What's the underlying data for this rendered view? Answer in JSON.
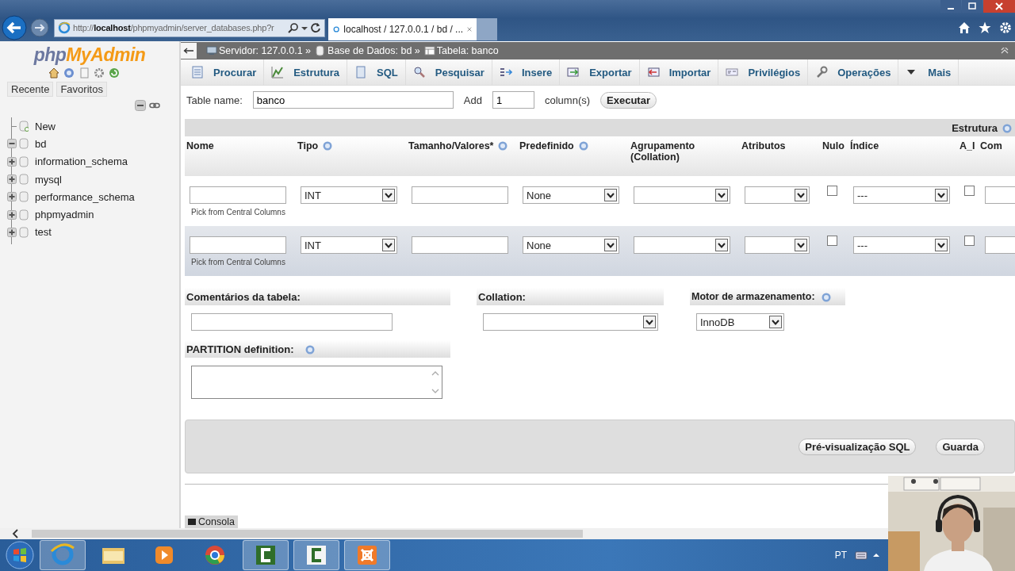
{
  "browser": {
    "address": "http://**localhost**/phpmyadmin/server_databases.php?r",
    "tabs": [
      {
        "title": "localhost / 127.0.0.1 / bd / ...",
        "selected": true
      }
    ]
  },
  "sidebar": {
    "logo": [
      "php",
      "MyAdmin"
    ],
    "tabs": [
      {
        "label": "Recente"
      },
      {
        "label": "Favoritos"
      }
    ],
    "tree": [
      {
        "label": "New",
        "kind": "new"
      },
      {
        "label": "bd",
        "kind": "database",
        "expanded": true
      },
      {
        "label": "information_schema",
        "kind": "database",
        "expanded": false
      },
      {
        "label": "mysql",
        "kind": "database",
        "expanded": false
      },
      {
        "label": "performance_schema",
        "kind": "database",
        "expanded": false
      },
      {
        "label": "phpmyadmin",
        "kind": "database",
        "expanded": false
      },
      {
        "label": "test",
        "kind": "database",
        "expanded": false
      }
    ]
  },
  "breadcrumb": [
    {
      "label": "Servidor: 127.0.0.1 »",
      "kind": "server"
    },
    {
      "label": "Base de Dados: bd »",
      "kind": "database"
    },
    {
      "label": "Tabela: banco",
      "kind": "table"
    }
  ],
  "menu": [
    {
      "label": "Procurar",
      "kind": "browse"
    },
    {
      "label": "Estrutura",
      "kind": "structure"
    },
    {
      "label": "SQL",
      "kind": "sql"
    },
    {
      "label": "Pesquisar",
      "kind": "search"
    },
    {
      "label": "Insere",
      "kind": "insert"
    },
    {
      "label": "Exportar",
      "kind": "export"
    },
    {
      "label": "Importar",
      "kind": "import"
    },
    {
      "label": "Privilégios",
      "kind": "privileges"
    },
    {
      "label": "Operações",
      "kind": "operations"
    },
    {
      "label": "Mais",
      "kind": "more"
    }
  ],
  "form": {
    "table_name_label": "Table name:",
    "table_name": "banco",
    "add_label": "Add",
    "add_count": "1",
    "columns_label": "column(s)",
    "execute": "Executar"
  },
  "table": {
    "group_title": "Estrutura",
    "columns": [
      {
        "label": "Nome"
      },
      {
        "label": "Tipo",
        "help": true
      },
      {
        "label": "Tamanho/Valores*",
        "help": true
      },
      {
        "label": "Predefinido",
        "help": true
      },
      {
        "label": "Agrupamento (Collation)"
      },
      {
        "label": "Atributos"
      },
      {
        "label": "Nulo"
      },
      {
        "label": "Índice"
      },
      {
        "label": "A_I"
      },
      {
        "label": "Com"
      }
    ],
    "rows": [
      {
        "type": "INT",
        "default": "None",
        "index": "---",
        "null": false,
        "ai": false,
        "pick": "Pick from Central Columns"
      },
      {
        "type": "INT",
        "default": "None",
        "index": "---",
        "null": false,
        "ai": false,
        "pick": "Pick from Central Columns"
      }
    ]
  },
  "options": {
    "comments_label": "Comentários da tabela:",
    "collation_label": "Collation:",
    "engine_label": "Motor de armazenamento:",
    "engine": "InnoDB",
    "partition_label": "PARTITION definition:"
  },
  "buttons": [
    {
      "label": "Pré-visualização SQL"
    },
    {
      "label": "Guarda"
    }
  ],
  "console": "Consola",
  "tray": {
    "language": "PT"
  }
}
